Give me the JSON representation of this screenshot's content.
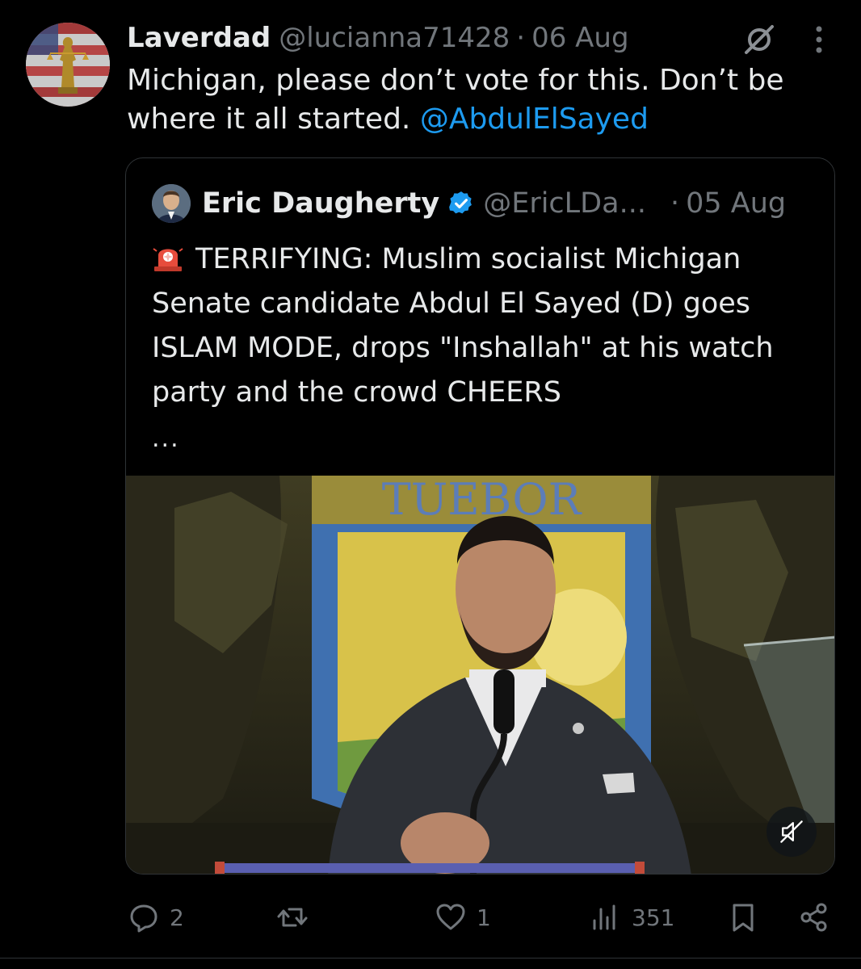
{
  "tweet": {
    "author_name": "Laverdad",
    "author_handle": "@lucianna71428",
    "separator": "·",
    "date": "06 Aug",
    "text_before_mention": "Michigan, please don’t vote for this. Don’t be where it all started. ",
    "mention": "@AbdulElSayed",
    "avatar_icon": "lady-justice-flag-avatar",
    "grok_icon": "grok-icon",
    "more_icon": "more-options-icon"
  },
  "quote": {
    "author_name": "Eric Daugherty",
    "verified_icon": "verified-badge-icon",
    "author_handle": "@EricLDa...",
    "separator": "·",
    "date": "05 Aug",
    "emoji": "🚨",
    "text": "TERRIFYING: Muslim socialist Michigan Senate candidate Abdul El Sayed (D) goes ISLAM MODE, drops \"Inshallah\" at his watch party and the crowd CHEERS",
    "ellipsis": "...",
    "media_banner_text": "TUEBOR",
    "mute_icon": "speaker-muted-icon"
  },
  "actions": {
    "reply_count": "2",
    "retweet_count": "",
    "like_count": "1",
    "views_count": "351"
  },
  "colors": {
    "background": "#000000",
    "text_primary": "#e7e9ea",
    "text_secondary": "#71767b",
    "accent": "#1d9bf0",
    "border": "#2f3336"
  }
}
